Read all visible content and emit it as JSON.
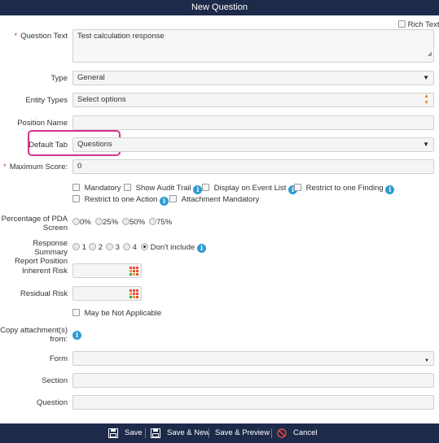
{
  "dialog": {
    "title": "New Question"
  },
  "rich_text_label": "Rich Text",
  "fields": {
    "question_text": {
      "label": "Question Text",
      "value": "Test calculation response"
    },
    "type": {
      "label": "Type",
      "value": "General"
    },
    "entity_types": {
      "label": "Entity Types",
      "value": "Select options"
    },
    "position_name": {
      "label": "Position Name",
      "value": ""
    },
    "default_tab": {
      "label": "Default Tab",
      "value": "Questions"
    },
    "maximum_score": {
      "label": "Maximum Score:",
      "value": "0"
    }
  },
  "checkboxes": {
    "mandatory": "Mandatory",
    "show_audit_trail": "Show Audit Trail",
    "display_on_event_list": "Display on Event List",
    "restrict_one_finding": "Restrict to one Finding",
    "restrict_one_action": "Restrict to one Action",
    "attachment_mandatory": "Attachment Mandatory"
  },
  "pda_screen": {
    "label_line1": "Percentage of PDA",
    "label_line2": "Screen",
    "options": [
      "0%",
      "25%",
      "50%",
      "75%"
    ]
  },
  "response_summary": {
    "label_line1": "Response Summary",
    "label_line2": "Report Position",
    "options": [
      "1",
      "2",
      "3",
      "4",
      "Don't include"
    ],
    "selected": "Don't include"
  },
  "inherent_risk": {
    "label": "Inherent Risk"
  },
  "residual_risk": {
    "label": "Residual Risk"
  },
  "may_be_na": "May be Not Applicable",
  "copy_attachments": {
    "label_line1": "Copy attachment(s)",
    "label_line2": "from:"
  },
  "form": {
    "label": "Form",
    "value": ""
  },
  "section": {
    "label": "Section",
    "value": ""
  },
  "question": {
    "label": "Question",
    "value": ""
  },
  "footer": {
    "save": "Save",
    "save_new": "Save & New",
    "save_preview": "Save & Preview",
    "cancel": "Cancel"
  },
  "colors": {
    "header_bg": "#1e2a4a",
    "highlight": "#d6338a",
    "info": "#2e9bd6",
    "required": "#c0392b"
  }
}
